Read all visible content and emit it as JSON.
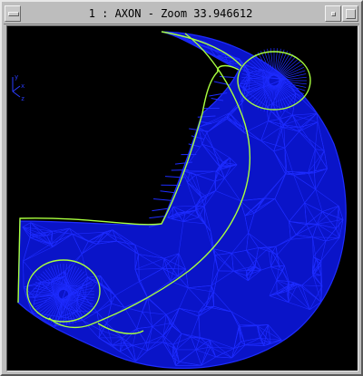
{
  "window": {
    "title": "1 : AXON - Zoom 33.946612"
  },
  "axes": {
    "x_label": "x",
    "y_label": "y",
    "z_label": "z"
  },
  "colors": {
    "background": "#000000",
    "mesh": "#1e2cff",
    "mesh_dark": "#0a14c8",
    "curves": "#a8ff3e",
    "axis_icon": "#2a3cff",
    "chrome": "#bdbdbd"
  },
  "icons": {
    "menu": "window-menu-icon",
    "minimize": "minimize-icon",
    "maximize": "maximize-icon",
    "axis": "axis-triad-icon"
  }
}
